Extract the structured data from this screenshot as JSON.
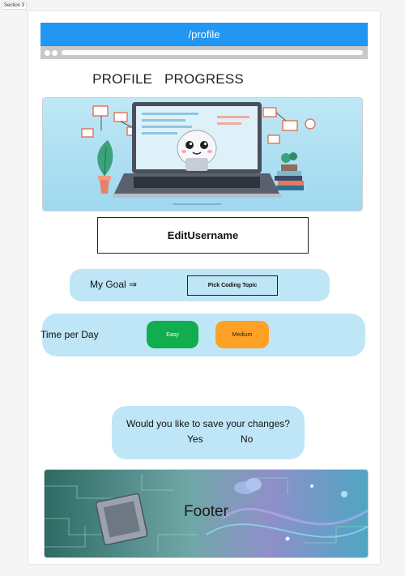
{
  "section_label": "Section 3",
  "window": {
    "title": "/profile"
  },
  "page": {
    "title": "PROFILE   PROGRESS",
    "edit_username_label": "EditUsername",
    "goal": {
      "label": "My Goal ⇒",
      "button_label": "Pick Coding Topic"
    },
    "time": {
      "label": "Time per Day",
      "easy_label": "Easy",
      "medium_label": "Medium"
    },
    "save": {
      "question": "Would you like to save your changes?",
      "yes": "Yes",
      "no": "No"
    },
    "footer": {
      "label": "Footer"
    }
  },
  "colors": {
    "titlebar": "#2196f3",
    "panel": "#bfe6f7",
    "easy": "#12ad4f",
    "medium": "#ffa124"
  }
}
